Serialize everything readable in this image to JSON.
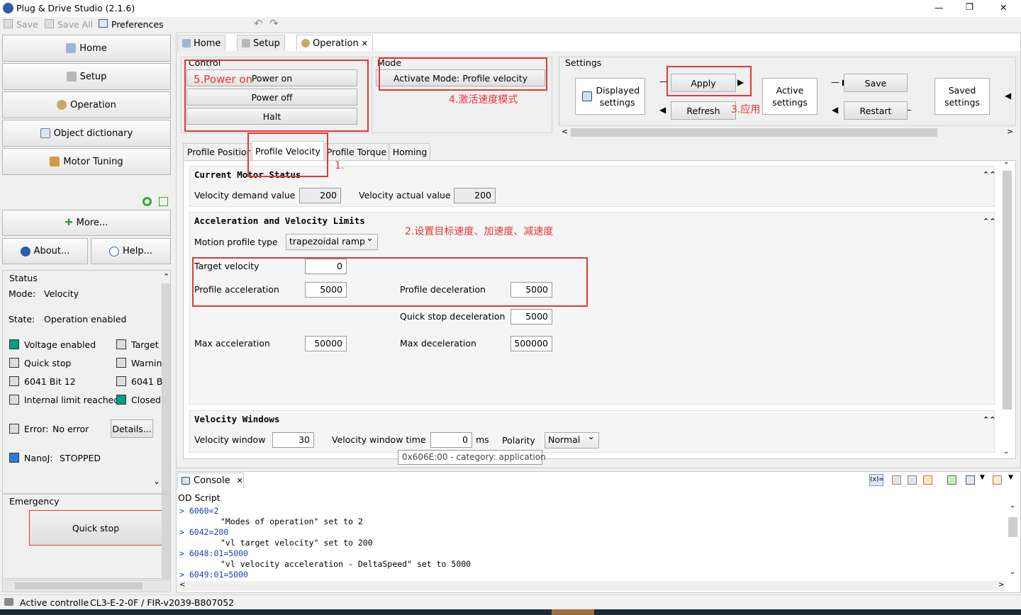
{
  "window": {
    "title": "Plug & Drive Studio (2.1.6)",
    "min": "—",
    "max": "❐",
    "close": "✕"
  },
  "toolbar": {
    "save": "Save",
    "save_all": "Save All",
    "preferences": "Preferences",
    "undo": "↶",
    "redo": "↷"
  },
  "nav": {
    "home": "Home",
    "setup": "Setup",
    "operation": "Operation",
    "object_dictionary": "Object dictionary",
    "motor_tuning": "Motor Tuning",
    "more": "More...",
    "about": "About...",
    "help": "Help..."
  },
  "status": {
    "title": "Status",
    "mode_label": "Mode:",
    "mode_value": "Velocity",
    "state_label": "State:",
    "state_value": "Operation enabled",
    "flags": [
      {
        "label": "Voltage enabled",
        "on": true
      },
      {
        "label": "Target",
        "on": false
      },
      {
        "label": "Quick stop",
        "on": false
      },
      {
        "label": "Warnin",
        "on": false
      },
      {
        "label": "6041 Bit 12",
        "on": false
      },
      {
        "label": "6041 B",
        "on": false
      },
      {
        "label": "Internal limit reached",
        "on": false
      },
      {
        "label": "Closed",
        "on": true
      }
    ],
    "error_label": "Error:",
    "error_value": "No error",
    "details": "Details...",
    "nanoj_label": "NanoJ:",
    "nanoj_value": "STOPPED"
  },
  "emergency": {
    "title": "Emergency",
    "quick_stop": "Quick stop"
  },
  "tabs": {
    "home": "Home",
    "setup": "Setup",
    "operation": "Operation"
  },
  "control": {
    "title": "Control",
    "power_on": "Power on",
    "power_off": "Power off",
    "halt": "Halt"
  },
  "mode": {
    "title": "Mode",
    "activate": "Activate Mode: Profile velocity"
  },
  "settings": {
    "title": "Settings",
    "displayed": "Displayed settings",
    "apply": "Apply",
    "refresh": "Refresh",
    "active": "Active settings",
    "save": "Save",
    "restart": "Restart",
    "saved": "Saved settings"
  },
  "subtabs": [
    "Profile Position",
    "Profile Velocity",
    "Profile Torque",
    "Homing"
  ],
  "motor_status": {
    "title": "Current Motor Status",
    "vel_demand_label": "Velocity demand value",
    "vel_demand": "200",
    "vel_actual_label": "Velocity actual value",
    "vel_actual": "200"
  },
  "limits": {
    "title": "Acceleration and Velocity Limits",
    "profile_type_label": "Motion profile type",
    "profile_type": "trapezoidal ramp",
    "target_velocity_label": "Target velocity",
    "target_velocity": "0",
    "profile_acc_label": "Profile acceleration",
    "profile_acc": "5000",
    "profile_dec_label": "Profile deceleration",
    "profile_dec": "5000",
    "qs_dec_label": "Quick stop deceleration",
    "qs_dec": "5000",
    "max_acc_label": "Max acceleration",
    "max_acc": "50000",
    "max_dec_label": "Max deceleration",
    "max_dec": "500000"
  },
  "windows": {
    "title": "Velocity Windows",
    "window_label": "Velocity window",
    "window": "30",
    "window_time_label": "Velocity window time",
    "window_time": "0",
    "unit": "ms",
    "polarity_label": "Polarity",
    "polarity": "Normal"
  },
  "tooltip": "0x606E:00 - category: application",
  "console": {
    "title": "Console",
    "subtitle": "OD Script",
    "lines": [
      {
        "cmd": "6060=2",
        "msg": "\"Modes of operation\" set to 2"
      },
      {
        "cmd": "6042=200",
        "msg": "\"vl target velocity\" set to 200"
      },
      {
        "cmd": "6048:01=5000",
        "msg": "\"vl velocity acceleration - DeltaSpeed\" set to 5000"
      },
      {
        "cmd": "6049:01=5000",
        "msg": ""
      }
    ]
  },
  "statusbar": {
    "text": "Active controlle",
    "device": "CL3-E-2-0F / FIR-v2039-B807052"
  },
  "annotations": {
    "a1": "1.",
    "a2": "2.设置目标速度、加速度、减速度",
    "a3": "3.应用",
    "a4": "4.激活速度模式",
    "a5": "5.Power on"
  },
  "colors": {
    "on": "#00a080",
    "annotation": "#e63636"
  }
}
